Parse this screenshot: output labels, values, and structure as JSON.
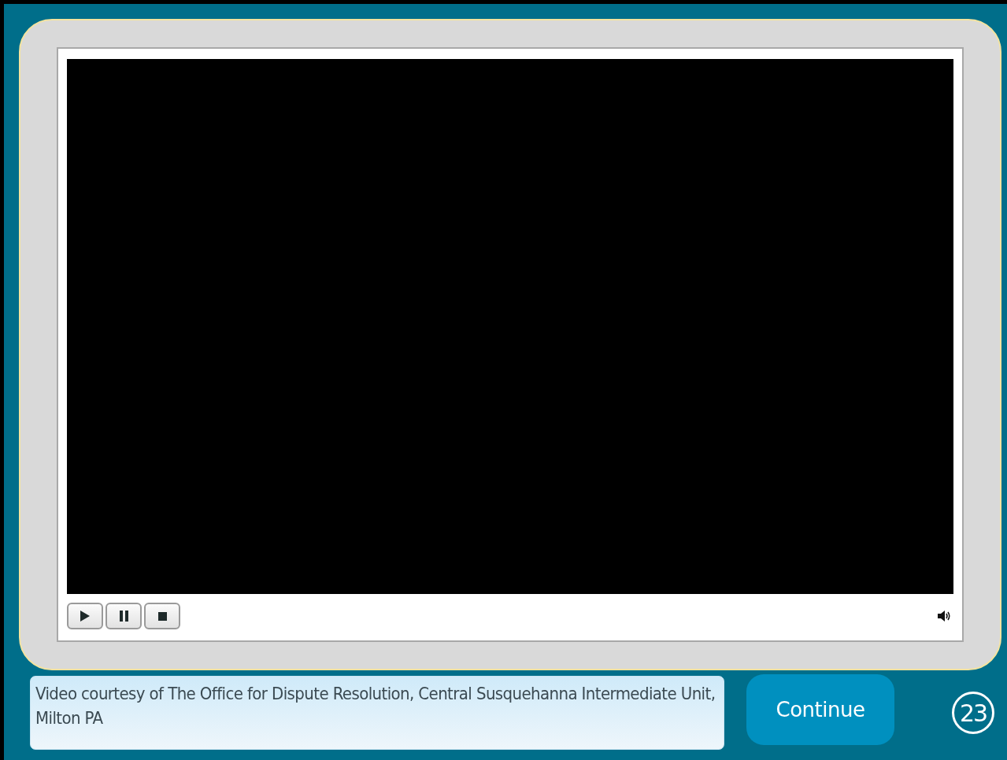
{
  "player": {
    "controls": [
      {
        "kind": "play"
      },
      {
        "kind": "pause"
      },
      {
        "kind": "stop"
      }
    ],
    "volume": {
      "kind": "speaker"
    }
  },
  "caption": "Video courtesy of The Office for Dispute Resolution, Central Susquehanna Intermediate Unit, Milton PA",
  "continue_button": "Continue",
  "page_number": "23"
}
